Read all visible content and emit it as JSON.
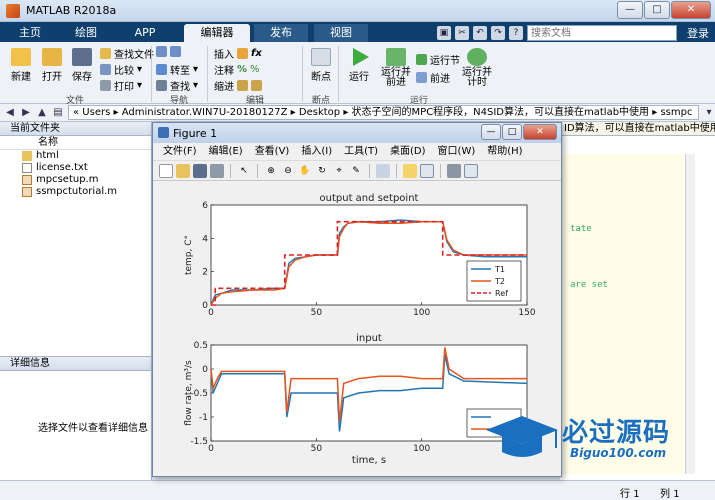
{
  "app": {
    "title": "MATLAB R2018a"
  },
  "tabs": [
    {
      "label": "主页"
    },
    {
      "label": "绘图"
    },
    {
      "label": "APP"
    },
    {
      "label": "编辑器"
    },
    {
      "label": "发布"
    },
    {
      "label": "视图"
    }
  ],
  "search": {
    "placeholder": "搜索文档"
  },
  "login_label": "登录",
  "ribbon": {
    "new_label": "新建",
    "open_label": "打开",
    "save_label": "保存",
    "find_files_label": "查找文件",
    "compare_label": "比较",
    "print_label": "打印",
    "goto_label": "转至",
    "find_label": "查找",
    "insert_label": "插入",
    "comment_label": "注释",
    "indent_label": "缩进",
    "breakpoint_label": "断点",
    "run_label": "运行",
    "run_advance_label": "运行并\n前进",
    "run_section_label": "运行节",
    "advance_label": "前进",
    "run_time_label": "运行并\n计时",
    "groups": {
      "file": "文件",
      "nav": "导航",
      "edit": "编辑",
      "breakpoints": "断点",
      "run": "运行"
    }
  },
  "address": {
    "path_segments": [
      "Users",
      "Administrator.WIN7U-20180127Z",
      "Desktop",
      "状态子空间的MPC程序段，N4SID算法，可以直接在matlab中使用",
      "ssmpc"
    ]
  },
  "current_folder": {
    "title": "当前文件夹",
    "column": "名称",
    "files": [
      {
        "name": "html",
        "type": "folder"
      },
      {
        "name": "license.txt",
        "type": "text"
      },
      {
        "name": "mpcsetup.m",
        "type": "mfile"
      },
      {
        "name": "ssmpctutorial.m",
        "type": "mfile"
      }
    ]
  },
  "details": {
    "title": "详细信息",
    "message": "选择文件以查看详细信息"
  },
  "editor": {
    "header": "ID算法，可以直接在matlab中使用",
    "code_fragments": [
      "tate",
      "are set"
    ]
  },
  "status": {
    "row_label": "行",
    "row_value": "1",
    "col_label": "列",
    "col_value": "1"
  },
  "figure": {
    "title": "Figure 1",
    "menu": [
      "文件(F)",
      "编辑(E)",
      "查看(V)",
      "插入(I)",
      "工具(T)",
      "桌面(D)",
      "窗口(W)",
      "帮助(H)"
    ]
  },
  "watermark": {
    "cn": "必过源码",
    "en": "Biguo100.com"
  },
  "colors": {
    "blue": "#1f77b4",
    "orange": "#e8541e",
    "ref": "#e02020",
    "tabbar": "#0e3f6d"
  },
  "chart_data": [
    {
      "type": "line",
      "title": "output and setpoint",
      "xlabel": "",
      "ylabel": "temp, C°",
      "xlim": [
        0,
        150
      ],
      "ylim": [
        0,
        6
      ],
      "xticks": [
        0,
        50,
        100,
        150
      ],
      "yticks": [
        0,
        2,
        4,
        6
      ],
      "legend_position": "bottom-right",
      "series": [
        {
          "name": "T1",
          "color": "#1f77b4",
          "style": "solid",
          "x": [
            0,
            2,
            5,
            10,
            20,
            30,
            35,
            37,
            40,
            45,
            50,
            60,
            61,
            63,
            65,
            70,
            80,
            90,
            100,
            110,
            112,
            115,
            120,
            130,
            140,
            150
          ],
          "y": [
            0,
            0.6,
            0.7,
            0.9,
            0.9,
            1.0,
            1.0,
            2.5,
            2.8,
            2.9,
            3.0,
            3.0,
            4.3,
            4.7,
            4.9,
            5.0,
            5.0,
            5.1,
            5.0,
            5.0,
            3.8,
            3.2,
            3.0,
            2.9,
            2.9,
            2.9
          ]
        },
        {
          "name": "T2",
          "color": "#e8541e",
          "style": "solid",
          "x": [
            0,
            2,
            5,
            10,
            20,
            30,
            35,
            37,
            40,
            45,
            50,
            60,
            61,
            63,
            65,
            70,
            80,
            90,
            100,
            110,
            112,
            115,
            120,
            130,
            140,
            150
          ],
          "y": [
            0,
            0.4,
            0.7,
            0.8,
            0.9,
            0.9,
            1.0,
            2.3,
            2.7,
            2.9,
            3.0,
            3.0,
            4.1,
            4.6,
            4.9,
            5.0,
            4.9,
            4.9,
            5.0,
            5.0,
            3.9,
            3.3,
            3.0,
            3.0,
            3.0,
            3.0
          ]
        },
        {
          "name": "Ref",
          "color": "#e02020",
          "style": "dashed",
          "x": [
            0,
            2,
            2,
            35,
            35,
            60,
            60,
            110,
            110,
            150
          ],
          "y": [
            0,
            0,
            1,
            1,
            3,
            3,
            5,
            5,
            3,
            3
          ]
        }
      ]
    },
    {
      "type": "line",
      "title": "input",
      "xlabel": "time, s",
      "ylabel": "flow rate, m³/s",
      "xlim": [
        0,
        150
      ],
      "ylim": [
        -1.5,
        0.5
      ],
      "xticks": [
        0,
        50,
        100,
        150
      ],
      "yticks": [
        -1.5,
        -1,
        -0.5,
        0,
        0.5
      ],
      "legend_position": "bottom-right",
      "series": [
        {
          "name": "u1",
          "color": "#1f77b4",
          "style": "solid",
          "x": [
            0,
            1,
            3,
            5,
            10,
            20,
            30,
            35,
            36,
            38,
            45,
            60,
            61,
            63,
            70,
            80,
            90,
            100,
            110,
            111,
            113,
            120,
            150
          ],
          "y": [
            0,
            -0.5,
            -0.3,
            -0.1,
            -0.1,
            -0.1,
            -0.1,
            -0.1,
            -1.0,
            -0.5,
            -0.5,
            -0.5,
            -1.3,
            -0.6,
            -0.5,
            -0.45,
            -0.45,
            -0.4,
            -0.4,
            0.3,
            -0.1,
            -0.25,
            -0.3
          ]
        },
        {
          "name": "u2",
          "color": "#e8541e",
          "style": "solid",
          "x": [
            0,
            1,
            3,
            5,
            10,
            20,
            30,
            35,
            36,
            38,
            45,
            60,
            61,
            63,
            70,
            80,
            90,
            100,
            110,
            111,
            113,
            120,
            150
          ],
          "y": [
            0,
            -0.4,
            -0.2,
            -0.05,
            -0.05,
            -0.05,
            -0.05,
            -0.05,
            -0.9,
            -0.2,
            -0.2,
            -0.2,
            -1.1,
            -0.3,
            -0.2,
            -0.15,
            -0.15,
            -0.2,
            -0.2,
            0.45,
            0.0,
            -0.2,
            -0.2
          ]
        }
      ]
    }
  ]
}
